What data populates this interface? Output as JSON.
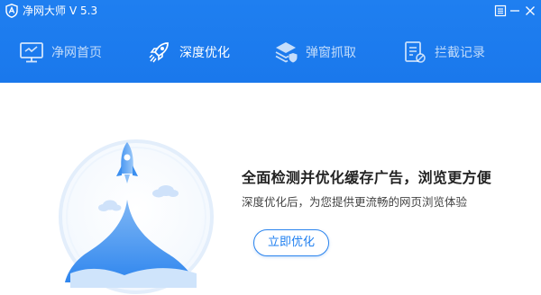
{
  "window": {
    "app_name": "净网大师",
    "version": "V 5.3"
  },
  "nav": {
    "items": [
      {
        "label": "净网首页",
        "icon": "monitor-icon",
        "active": false
      },
      {
        "label": "深度优化",
        "icon": "rocket-icon",
        "active": true
      },
      {
        "label": "弹窗抓取",
        "icon": "layers-shield-icon",
        "active": false
      },
      {
        "label": "拦截记录",
        "icon": "record-block-icon",
        "active": false
      }
    ]
  },
  "main": {
    "headline": "全面检测并优化缓存广告，浏览更方便",
    "subline": "深度优化后，为您提供更流畅的网页浏览体验",
    "button_label": "立即优化"
  },
  "colors": {
    "header_blue": "#1a78ec",
    "accent": "#2a84ee"
  }
}
